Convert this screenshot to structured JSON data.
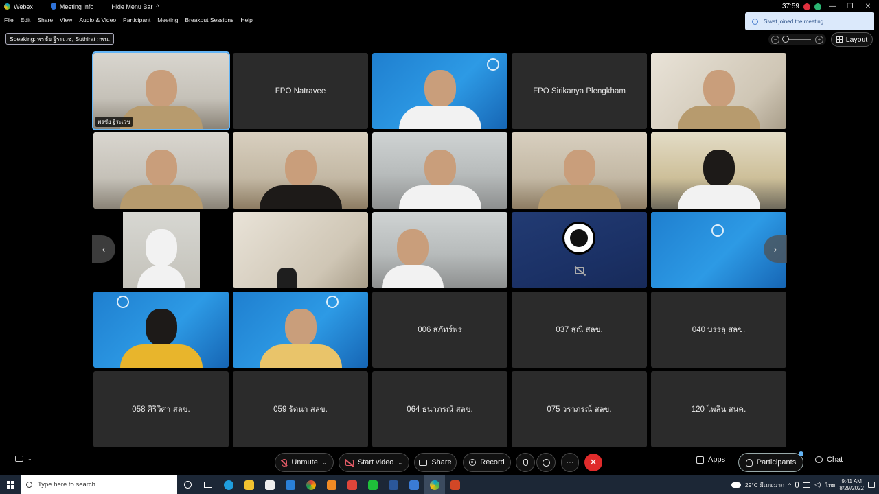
{
  "titlebar": {
    "app": "Webex",
    "meeting_info": "Meeting Info",
    "hide_menu": "Hide Menu Bar",
    "timer": "37:59"
  },
  "menu": [
    "File",
    "Edit",
    "Share",
    "View",
    "Audio & Video",
    "Participant",
    "Meeting",
    "Breakout Sessions",
    "Help"
  ],
  "speaking": "Speaking: พรชัย ฐีระเวช, Suthirat กพน.",
  "toast": "Siwat joined the meeting.",
  "layout_label": "Layout",
  "tiles": [
    {
      "name": "พรชัย ฐีระเวช"
    },
    {
      "name": "FPO Natravee"
    },
    {
      "name": ""
    },
    {
      "name": "FPO Sirikanya Plengkham"
    },
    {
      "name": ""
    },
    {
      "name": ""
    },
    {
      "name": ""
    },
    {
      "name": ""
    },
    {
      "name": ""
    },
    {
      "name": ""
    },
    {
      "name": ""
    },
    {
      "name": ""
    },
    {
      "name": ""
    },
    {
      "name": ""
    },
    {
      "name": ""
    },
    {
      "name": ""
    },
    {
      "name": ""
    },
    {
      "name": "006 สภัทร์พร"
    },
    {
      "name": "037 สุณี สลข."
    },
    {
      "name": "040 บรรลุ สลข."
    },
    {
      "name": "058 ศิริวิศา สลข."
    },
    {
      "name": "059 รัตนา สลข."
    },
    {
      "name": "064 ธนาภรณ์ สลข."
    },
    {
      "name": "075 วราภรณ์ สลข."
    },
    {
      "name": "120 ไพลิน สนค."
    }
  ],
  "controls": {
    "unmute": "Unmute",
    "start_video": "Start video",
    "share": "Share",
    "record": "Record",
    "more": "···",
    "end": "✕",
    "apps": "Apps",
    "participants": "Participants",
    "chat": "Chat"
  },
  "taskbar": {
    "search_placeholder": "Type here to search",
    "weather": "29°C มีเมฆมาก",
    "lang": "ไทย",
    "time": "9:41 AM",
    "date": "8/29/2022"
  },
  "colors": {
    "active_border": "#64b5f6",
    "end_red": "#e02b2b",
    "toast_bg": "#dbe9fb"
  }
}
